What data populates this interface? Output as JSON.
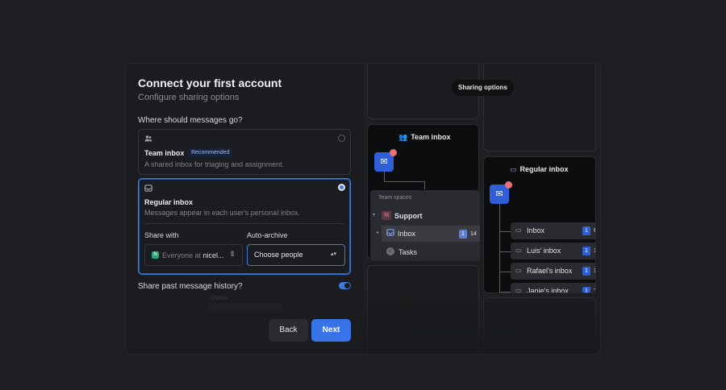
{
  "modal": {
    "title": "Connect your first account",
    "subtitle": "Configure sharing options",
    "question": "Where should messages go?",
    "options": {
      "team": {
        "icon": "users-icon",
        "title": "Team inbox",
        "badge": "Recommended",
        "description": "A shared inbox for triaging and assignment.",
        "selected": false
      },
      "regular": {
        "icon": "inbox-icon",
        "title": "Regular inbox",
        "description": "Messages appear in each user's personal inbox.",
        "selected": true,
        "share_with": {
          "label": "Share with",
          "chip": "N",
          "value_prefix": "Everyone at",
          "value_org": "nicel..."
        },
        "auto_archive": {
          "label": "Auto-archive",
          "placeholder": "Choose people"
        }
      }
    },
    "history": {
      "label": "Share past message history?",
      "enabled": true
    },
    "ghost_text": "Users",
    "back_label": "Back",
    "next_label": "Next",
    "accent_color": "#3874e8"
  },
  "illustration": {
    "pill": "Sharing options",
    "team_inbox": {
      "title": "Team inbox",
      "dropdown_header": "Team spaces",
      "space": "Support",
      "items": [
        {
          "label": "Inbox",
          "count_badge": "1",
          "count": "14"
        },
        {
          "label": "Tasks"
        }
      ]
    },
    "regular_inbox": {
      "title": "Regular inbox",
      "items": [
        {
          "label": "Inbox",
          "count_badge": "1",
          "count": "6"
        },
        {
          "label": "Luis' inbox",
          "count_badge": "1",
          "count": "14"
        },
        {
          "label": "Rafael's inbox",
          "count_badge": "1",
          "count": "3"
        },
        {
          "label": "Janie's inbox",
          "count_badge": "1",
          "count": "2"
        }
      ]
    }
  }
}
